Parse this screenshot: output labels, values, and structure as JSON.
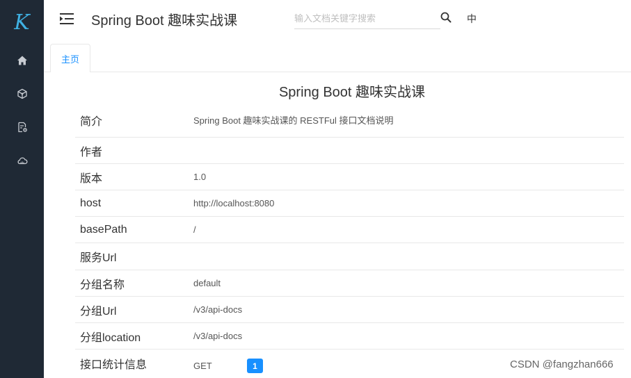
{
  "sidebar": {
    "logo": "K",
    "items": [
      {
        "icon": "home-icon"
      },
      {
        "icon": "cube-icon"
      },
      {
        "icon": "document-settings-icon"
      },
      {
        "icon": "cloud-icon"
      }
    ]
  },
  "header": {
    "title": "Spring Boot 趣味实战课",
    "search_placeholder": "输入文档关键字搜索",
    "lang": "中"
  },
  "tabs": [
    {
      "label": "主页",
      "active": true
    }
  ],
  "main": {
    "title": "Spring Boot 趣味实战课",
    "rows": [
      {
        "label": "简介",
        "value": "Spring Boot 趣味实战课的 RESTFul 接口文档说明"
      },
      {
        "label": "作者",
        "value": ""
      },
      {
        "label": "版本",
        "value": "1.0"
      },
      {
        "label": "host",
        "value": "http://localhost:8080"
      },
      {
        "label": "basePath",
        "value": "/"
      },
      {
        "label": "服务Url",
        "value": ""
      },
      {
        "label": "分组名称",
        "value": "default"
      },
      {
        "label": "分组Url",
        "value": "/v3/api-docs"
      },
      {
        "label": "分组location",
        "value": "/v3/api-docs"
      }
    ],
    "stats": {
      "label": "接口统计信息",
      "method": "GET",
      "count": "1"
    }
  },
  "watermark": "CSDN @fangzhan666",
  "colors": {
    "sidebar_bg": "#1f2935",
    "accent": "#1890ff",
    "logo": "#3fb1e3"
  }
}
